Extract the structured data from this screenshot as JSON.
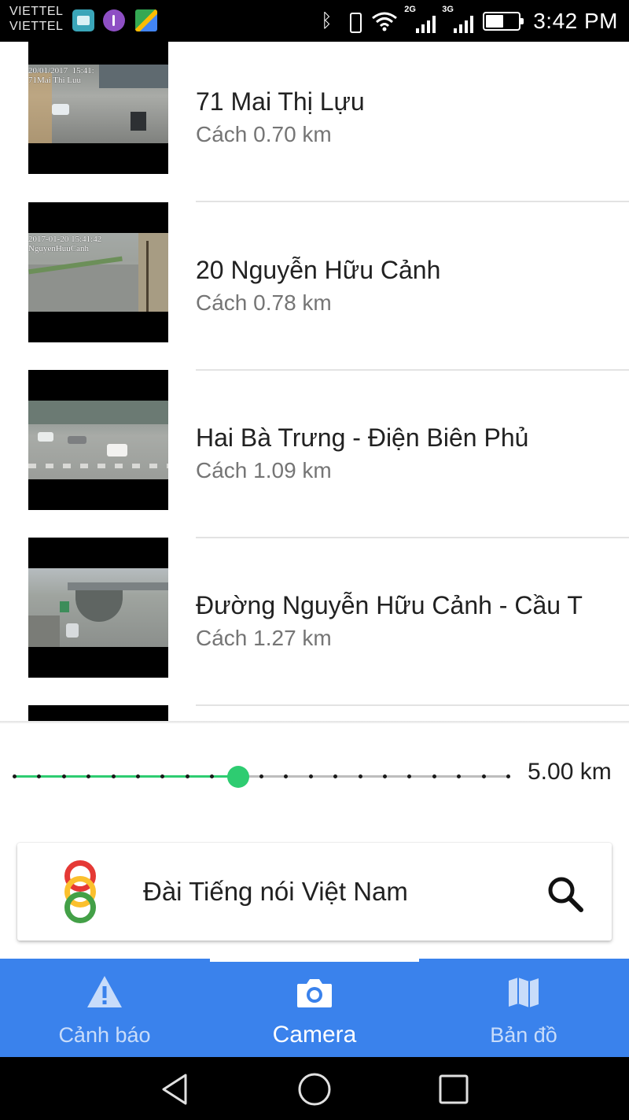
{
  "status_bar": {
    "carrier_1": "VIETTEL",
    "carrier_2": "VIETTEL",
    "network_1": "2G",
    "network_2": "3G",
    "time": "3:42 PM",
    "icons": [
      "gallery-icon",
      "viber-icon",
      "maps-icon",
      "bluetooth-icon",
      "vibrate-icon",
      "wifi-icon",
      "signal-icon",
      "battery-icon"
    ]
  },
  "cameras": [
    {
      "title": "71 Mai Thị Lựu",
      "distance": "Cách 0.70 km",
      "stamp": "20/01/2017  15:41:\n71Mai Thi Luu"
    },
    {
      "title": "20 Nguyễn Hữu Cảnh",
      "distance": "Cách 0.78 km",
      "stamp": "2017-01-20 15:41:42\nNguyenHuuCanh"
    },
    {
      "title": "Hai Bà Trưng - Điện Biên Phủ",
      "distance": "Cách 1.09 km",
      "stamp": ""
    },
    {
      "title": "Đường Nguyễn Hữu Cảnh - Cầu T",
      "distance": "Cách 1.27 km",
      "stamp": ""
    }
  ],
  "radius_slider": {
    "label": "5.00 km",
    "value_fraction": 0.4545,
    "tick_count": 20,
    "accent": "#2ecc71"
  },
  "search": {
    "value": "Đài Tiếng nói Việt Nam",
    "icon": "search-icon"
  },
  "bottom_nav": {
    "accent": "#3a82ec",
    "tabs": [
      {
        "label": "Cảnh báo",
        "icon": "warning-icon",
        "active": false
      },
      {
        "label": "Camera",
        "icon": "camera-icon",
        "active": true
      },
      {
        "label": "Bản đồ",
        "icon": "map-icon",
        "active": false
      }
    ]
  },
  "system_nav": {
    "buttons": [
      "back-icon",
      "home-icon",
      "recents-icon"
    ]
  }
}
